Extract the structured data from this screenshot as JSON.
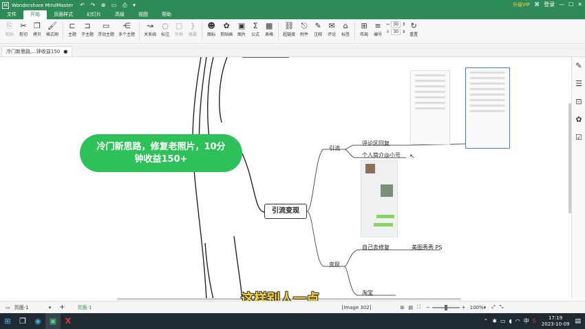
{
  "app": {
    "title": "Wondershare MindMaster",
    "vip_label": "升级VIP",
    "user_label": "登录"
  },
  "menu": [
    "文件",
    "开始",
    "页面样式",
    "幻灯片",
    "高级",
    "视图",
    "帮助"
  ],
  "ribbon": {
    "buttons": [
      "粘贴",
      "剪切",
      "拷贝",
      "格式刷",
      "主题",
      "子主题",
      "浮动主题",
      "多个主题",
      "关系线",
      "标注",
      "外框",
      "概要",
      "图标",
      "剪贴画",
      "图片",
      "公式",
      "表格",
      "超链接",
      "附件",
      "注释",
      "评论",
      "标签",
      "布局",
      "编号"
    ],
    "spacing_h": "30",
    "spacing_v": "30",
    "reset_label": "重置"
  },
  "tab": {
    "doc_title": "冷门新思路,...钟收益150"
  },
  "mindmap": {
    "central": "冷门新思路，修复老照片，10分钟收益150+",
    "main_topic": "引流变现",
    "branch_yinliu": "引流",
    "branch_bianxian": "变现",
    "sub_comment": "评论区回复",
    "sub_profile": "个人简介@小号",
    "sub_self_repair": "自己去修复",
    "sub_tools": "美图秀秀  PS",
    "sub_taobao": "淘宝"
  },
  "subtitle": "这样别人一点",
  "status": {
    "page_select": "页面-1",
    "page_tab": "页面-1",
    "image_info": "[Image 302]",
    "zoom": "100%"
  },
  "taskbar": {
    "ime": "中",
    "time": "17:19",
    "date": "2023-10-09"
  },
  "colors": {
    "brand": "#2e8b57",
    "central": "#2ec15a",
    "subtitle": "#f5d23c"
  }
}
